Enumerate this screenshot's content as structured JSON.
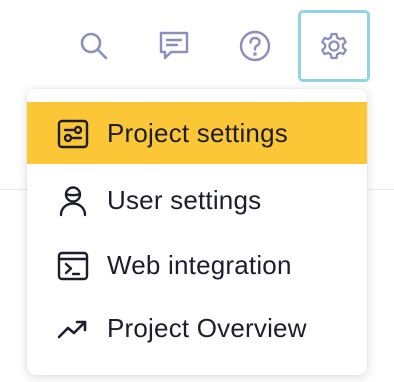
{
  "toolbar": {
    "icons": [
      "search-icon",
      "chat-icon",
      "help-icon",
      "gear-icon"
    ],
    "icon_color": "#8b8fc0",
    "focus_ring_color": "#8fd4e6"
  },
  "settings_menu": {
    "active_color": "#fbc736",
    "items": [
      {
        "label": "Project settings",
        "icon": "project-settings-icon",
        "active": true
      },
      {
        "label": "User settings",
        "icon": "user-icon",
        "active": false
      },
      {
        "label": "Web integration",
        "icon": "terminal-icon",
        "active": false
      },
      {
        "label": "Project Overview",
        "icon": "trending-up-icon",
        "active": false
      }
    ]
  }
}
